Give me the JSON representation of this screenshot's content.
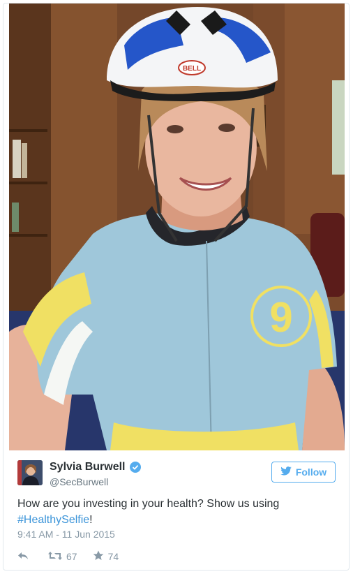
{
  "tweet": {
    "author_name": "Sylvia Burwell",
    "handle": "@SecBurwell",
    "follow_label": "Follow",
    "text_before": "How are you investing in your health? Show us using ",
    "hashtag": "#HealthySelfie",
    "text_after": "!",
    "timestamp": "9:41 AM - 11 Jun 2015",
    "retweets": "67",
    "likes": "74"
  },
  "photo": {
    "helmet_brand": "BELL",
    "jersey_number": "9"
  },
  "colors": {
    "accent": "#55acee",
    "hashtag": "#3b94d9",
    "muted": "#8899a6"
  },
  "icons": {
    "verified": "verified-badge-icon",
    "follow": "twitter-bird-icon",
    "reply": "reply-icon",
    "retweet": "retweet-icon",
    "like": "star-icon"
  }
}
